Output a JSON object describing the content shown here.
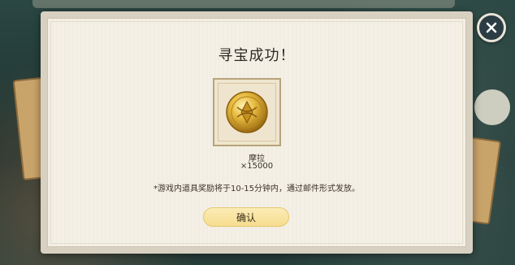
{
  "dialog": {
    "title": "寻宝成功！",
    "reward": {
      "name": "摩拉",
      "count": "×15000",
      "icon": "mora-coin-icon"
    },
    "notice": "*游戏内道具奖励将于10-15分钟内，通过邮件形式发放。",
    "confirm_label": "确认"
  },
  "close_icon": "close-icon",
  "colors": {
    "panel": "#f4f0e6",
    "button": "#f6dc8e",
    "coin": "#d9a92a"
  }
}
